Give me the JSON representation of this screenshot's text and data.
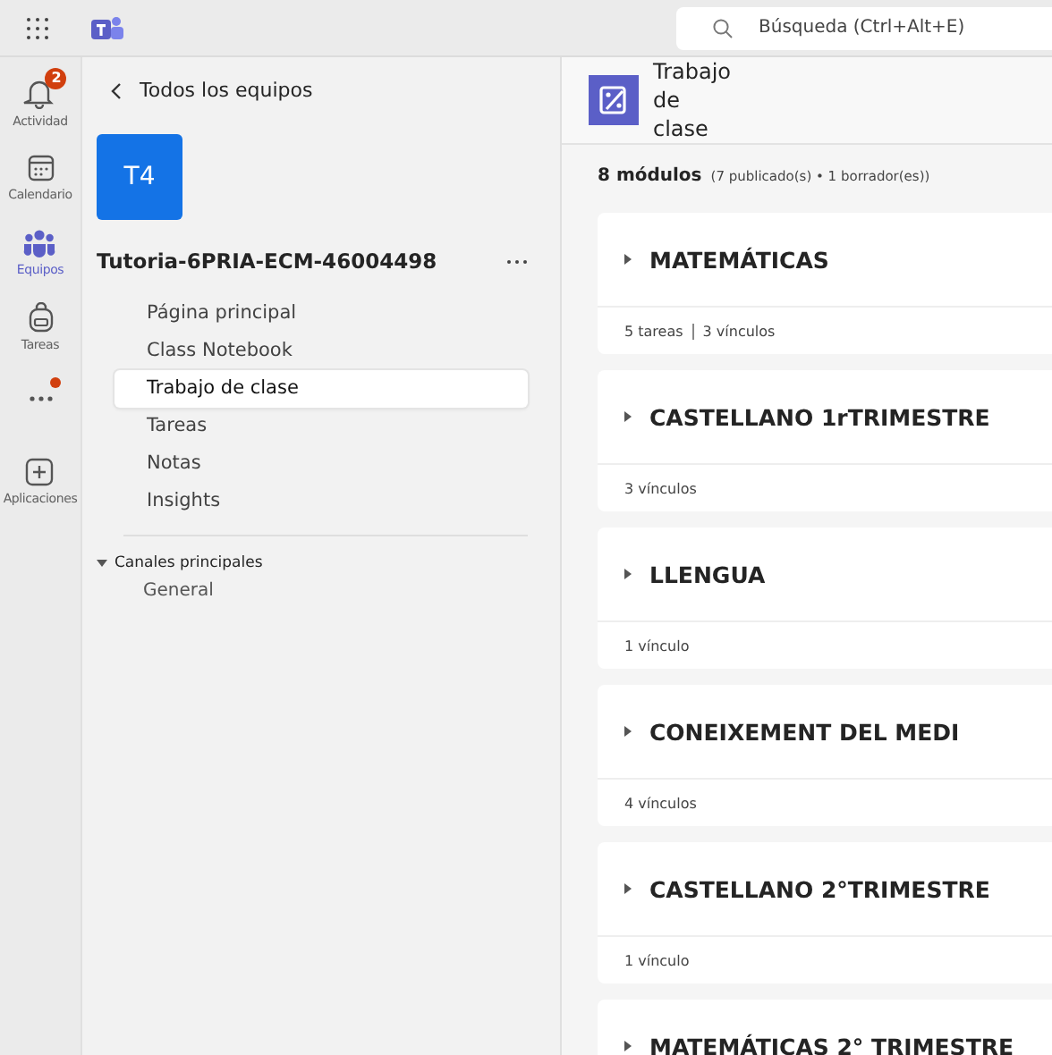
{
  "search": {
    "placeholder": "Búsqueda (Ctrl+Alt+E)"
  },
  "rail": [
    {
      "kind": "bell",
      "label": "Actividad",
      "badge": "2",
      "selected": false,
      "dot": false
    },
    {
      "kind": "calendar",
      "label": "Calendario",
      "selected": false,
      "dot": false
    },
    {
      "kind": "people",
      "label": "Equipos",
      "selected": true,
      "dot": false
    },
    {
      "kind": "bag",
      "label": "Tareas",
      "selected": false,
      "dot": false
    },
    {
      "kind": "more",
      "selected": false,
      "dot": true
    },
    {
      "kind": "apps",
      "label": "Aplicaciones",
      "selected": false,
      "dot": false
    }
  ],
  "sidebar": {
    "back": "Todos los equipos",
    "team_avatar": "T4",
    "team_name": "Tutoria-6PRIA-ECM-46004498",
    "items": [
      {
        "label": "Página principal",
        "selected": false
      },
      {
        "label": "Class Notebook",
        "selected": false
      },
      {
        "label": "Trabajo de clase",
        "selected": true
      },
      {
        "label": "Tareas",
        "selected": false
      },
      {
        "label": "Notas",
        "selected": false
      },
      {
        "label": "Insights",
        "selected": false
      }
    ],
    "channels": {
      "label": "Canales principales",
      "expanded": true,
      "children": [
        "General"
      ]
    }
  },
  "main": {
    "title": "Trabajo de clase",
    "count": "8 módulos",
    "summary": "(7 publicado(s) • 1 borrador(es))",
    "modules": [
      {
        "title": "MATEMÁTICAS",
        "meta": [
          "5 tareas",
          "3 vínculos"
        ]
      },
      {
        "title": "CASTELLANO 1rTRIMESTRE",
        "meta": [
          "3 vínculos"
        ]
      },
      {
        "title": "LLENGUA",
        "meta": [
          "1 vínculo"
        ]
      },
      {
        "title": "CONEIXEMENT DEL MEDI",
        "meta": [
          "4 vínculos"
        ]
      },
      {
        "title": "CASTELLANO 2°TRIMESTRE",
        "meta": [
          "1 vínculo"
        ]
      },
      {
        "title": "MATEMÁTICAS 2° TRIMESTRE"
      }
    ]
  }
}
